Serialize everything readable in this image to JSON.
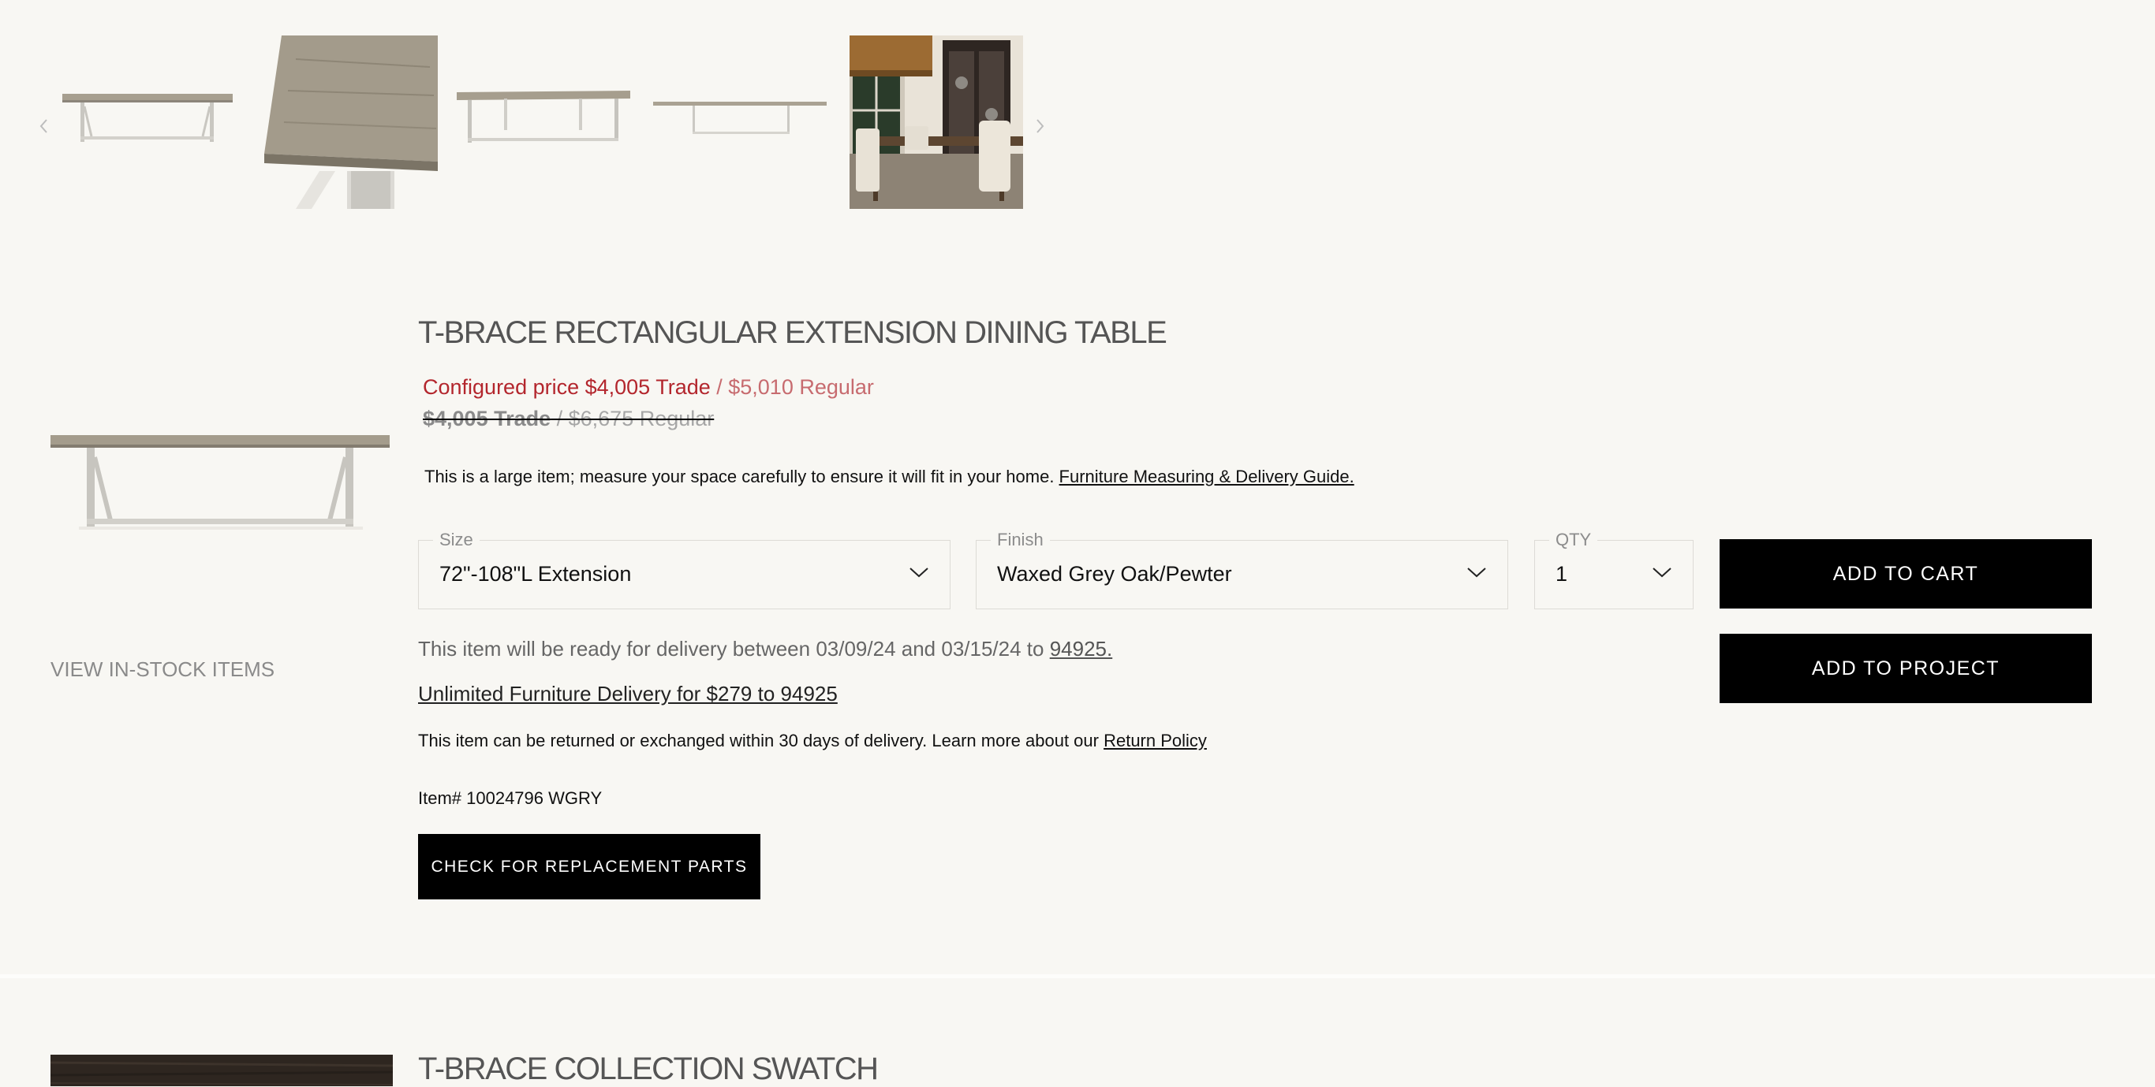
{
  "carousel": {
    "prev_icon": "chevron-left-icon",
    "next_icon": "chevron-right-icon",
    "thumbnails": [
      {
        "name": "table-side-view-thumbnail"
      },
      {
        "name": "tabletop-closeup-thumbnail"
      },
      {
        "name": "table-angle-view-thumbnail"
      },
      {
        "name": "table-extended-view-thumbnail"
      },
      {
        "name": "dining-room-scene-thumbnail"
      }
    ]
  },
  "product": {
    "title": "T-BRACE RECTANGULAR EXTENSION DINING TABLE",
    "configured_trade": "Configured price $4,005 Trade",
    "configured_regular": " / $5,010 Regular",
    "original_trade": "$4,005 Trade",
    "original_regular": " / $6,675 Regular",
    "size_note": "This is a large item; measure your space carefully to ensure it will fit in your home. ",
    "size_note_link": "Furniture Measuring & Delivery Guide.",
    "view_instock": "VIEW IN-STOCK ITEMS",
    "options": {
      "size_label": "Size",
      "size_value": "72\"-108\"L Extension",
      "finish_label": "Finish",
      "finish_value": "Waxed Grey Oak/Pewter",
      "qty_label": "QTY",
      "qty_value": "1"
    },
    "add_to_cart": "ADD TO CART",
    "add_to_project": "ADD TO PROJECT",
    "delivery_text": "This item will be ready for delivery between 03/09/24 and 03/15/24 to ",
    "delivery_zip": "94925.",
    "unlimited_delivery": "Unlimited Furniture Delivery for $279 to 94925",
    "returns_text": "This item can be returned or exchanged within 30 days of delivery.  Learn more about our ",
    "returns_link": "Return Policy",
    "item_number": "Item# 10024796 WGRY",
    "replacement_parts": "CHECK FOR REPLACEMENT PARTS"
  },
  "swatch": {
    "title": "T-BRACE COLLECTION SWATCH"
  },
  "colors": {
    "background": "#f8f7f3",
    "trade_price": "#b3262d",
    "regular_price": "#c76b6f",
    "button": "#000000"
  }
}
